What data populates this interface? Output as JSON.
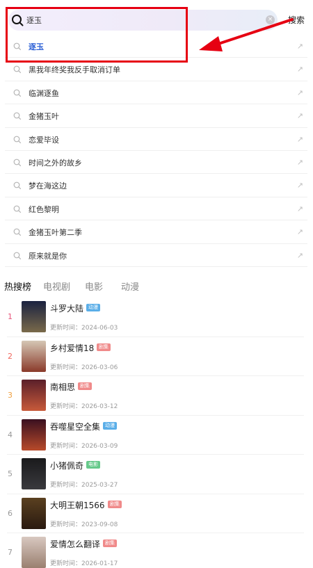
{
  "search": {
    "value": "逐玉",
    "button_label": "搜索"
  },
  "suggestions": [
    {
      "text": "逐玉",
      "highlight": true
    },
    {
      "text": "黑我年终奖我反手取消订单"
    },
    {
      "text": "临渊逐鱼"
    },
    {
      "text": "金猪玉叶"
    },
    {
      "text": "恋爱毕设"
    },
    {
      "text": "时间之外的故乡"
    },
    {
      "text": "梦在海这边"
    },
    {
      "text": "红色黎明"
    },
    {
      "text": "金猪玉叶第二季"
    },
    {
      "text": "原来就是你"
    }
  ],
  "tabs": [
    {
      "label": "热搜榜",
      "active": true
    },
    {
      "label": "电视剧"
    },
    {
      "label": "电影"
    },
    {
      "label": "动漫"
    }
  ],
  "hot_list": [
    {
      "rank": "1",
      "title": "斗罗大陆",
      "badge": "动漫",
      "badge_color": "#5aaee8",
      "date": "更新时间：2024-06-03",
      "rank_color": "#e8557a",
      "poster_top": "#1a2240",
      "poster_bottom": "#7a6a4a"
    },
    {
      "rank": "2",
      "title": "乡村爱情18",
      "badge": "剧集",
      "badge_color": "#f08a8a",
      "date": "更新时间：2026-03-06",
      "rank_color": "#f0645a",
      "poster_top": "#d5c7b5",
      "poster_bottom": "#8a3a2a"
    },
    {
      "rank": "3",
      "title": "南相思",
      "badge": "剧集",
      "badge_color": "#f08a8a",
      "date": "更新时间：2026-03-12",
      "rank_color": "#f0a040",
      "poster_top": "#5a1f2a",
      "poster_bottom": "#c85a3a"
    },
    {
      "rank": "4",
      "title": "吞噬星空全集",
      "badge": "动漫",
      "badge_color": "#5aaee8",
      "date": "更新时间：2026-03-09",
      "rank_color": "#999999",
      "poster_top": "#3a1020",
      "poster_bottom": "#b84a2a"
    },
    {
      "rank": "5",
      "title": "小猪佩奇",
      "badge": "电影",
      "badge_color": "#66c98a",
      "date": "更新时间：2025-03-27",
      "rank_color": "#999999",
      "poster_top": "#1a1a1c",
      "poster_bottom": "#3a3a3e"
    },
    {
      "rank": "6",
      "title": "大明王朝1566",
      "badge": "剧集",
      "badge_color": "#f08a8a",
      "date": "更新时间：2023-09-08",
      "rank_color": "#999999",
      "poster_top": "#5a4020",
      "poster_bottom": "#2a1a10"
    },
    {
      "rank": "7",
      "title": "爱情怎么翻译",
      "badge": "剧集",
      "badge_color": "#f08a8a",
      "date": "更新时间：2026-01-17",
      "rank_color": "#999999",
      "poster_top": "#d8c8c0",
      "poster_bottom": "#9a8070"
    }
  ]
}
